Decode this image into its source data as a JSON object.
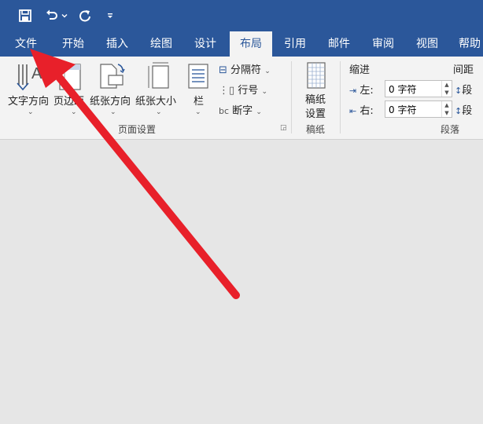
{
  "qat": {
    "save_icon": "save-icon",
    "undo_icon": "undo-icon",
    "undo_dropdown_icon": "chevron-down-icon",
    "redo_icon": "redo-icon",
    "customize_icon": "customize-qat-icon"
  },
  "tabs": [
    {
      "label": "文件"
    },
    {
      "label": "开始"
    },
    {
      "label": "插入"
    },
    {
      "label": "绘图"
    },
    {
      "label": "设计"
    },
    {
      "label": "布局"
    },
    {
      "label": "引用"
    },
    {
      "label": "邮件"
    },
    {
      "label": "审阅"
    },
    {
      "label": "视图"
    },
    {
      "label": "帮助"
    }
  ],
  "ribbon": {
    "page_setup": {
      "text_direction": "文字方向",
      "margins": "页边距",
      "orientation": "纸张方向",
      "size": "纸张大小",
      "columns": "栏",
      "breaks": "分隔符",
      "line_numbers": "行号",
      "hyphenation": "断字",
      "group_label": "页面设置"
    },
    "manuscript": {
      "setup_line1": "稿纸",
      "setup_line2": "设置",
      "group_label": "稿纸"
    },
    "paragraph": {
      "indent_title": "缩进",
      "spacing_title": "间距",
      "left_label": "左:",
      "right_label": "右:",
      "left_value": "0 字符",
      "right_value": "0 字符",
      "before_label": "段",
      "after_label": "段",
      "group_label": "段落"
    }
  },
  "colors": {
    "title_bar": "#2b579a",
    "annotation_arrow": "#e8202a"
  }
}
